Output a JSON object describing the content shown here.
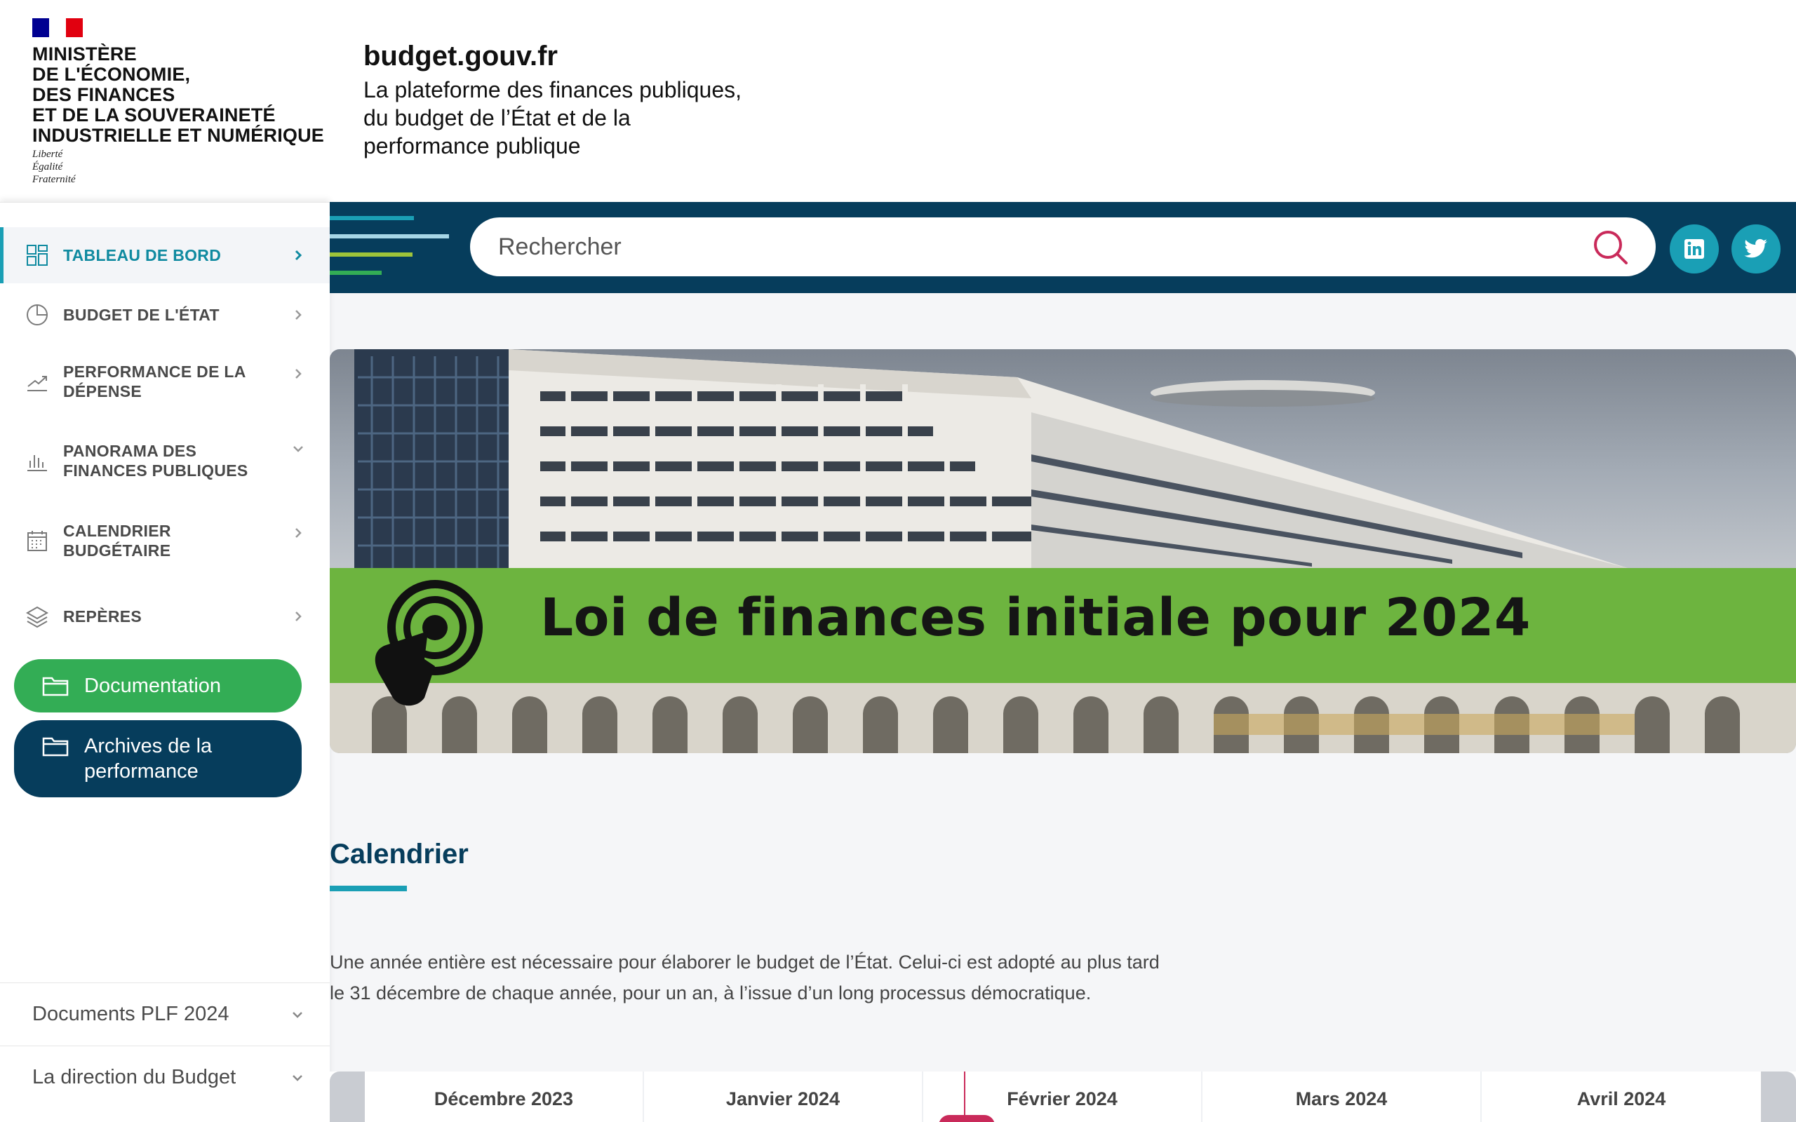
{
  "header": {
    "ministry": "MINISTÈRE\nDE L'ÉCONOMIE,\nDES FINANCES\nET DE LA SOUVERAINETÉ\nINDUSTRIELLE ET NUMÉRIQUE",
    "motto": "Liberté\nÉgalité\nFraternité",
    "site_name": "budget.gouv.fr",
    "site_tagline": "La plateforme des finances publiques,\ndu budget de l’État et de la\nperformance publique"
  },
  "sidebar": {
    "items": [
      {
        "label": "TABLEAU DE BORD",
        "icon": "dashboard-icon",
        "chevron": "right",
        "active": true
      },
      {
        "label": "BUDGET DE L'ÉTAT",
        "icon": "pie-chart-icon",
        "chevron": "right"
      },
      {
        "label": "PERFORMANCE DE LA DÉPENSE",
        "icon": "trend-up-icon",
        "chevron": "right"
      },
      {
        "label": "PANORAMA DES FINANCES PUBLIQUES",
        "icon": "bar-chart-icon",
        "chevron": "down"
      },
      {
        "label": "CALENDRIER BUDGÉTAIRE",
        "icon": "calendar-icon",
        "chevron": "right"
      },
      {
        "label": "REPÈRES",
        "icon": "layers-icon",
        "chevron": "right"
      }
    ],
    "documentation_label": "Documentation",
    "archives_label": "Archives de la performance",
    "footer_items": [
      {
        "label": "Documents PLF 2024"
      },
      {
        "label": "La direction du Budget"
      }
    ]
  },
  "search": {
    "placeholder": "Rechercher"
  },
  "social": [
    "linkedin-icon",
    "twitter-icon"
  ],
  "banner": {
    "title": "Loi de finances initiale pour 2024"
  },
  "calendar": {
    "title": "Calendrier",
    "description": "Une année entière est nécessaire pour élaborer le budget de l’État. Celui-ci est adopté au plus tard\nle 31 décembre de chaque année, pour un an, à l’issue d’un long processus démocratique.",
    "months": [
      "Décembre 2023",
      "Janvier 2024",
      "Février 2024",
      "Mars 2024",
      "Avril 2024"
    ]
  },
  "colors": {
    "navy": "#063d5c",
    "teal": "#1a9fb5",
    "green": "#33ad55",
    "banner_green": "#6db43f",
    "accent_pink": "#c92a5a"
  }
}
